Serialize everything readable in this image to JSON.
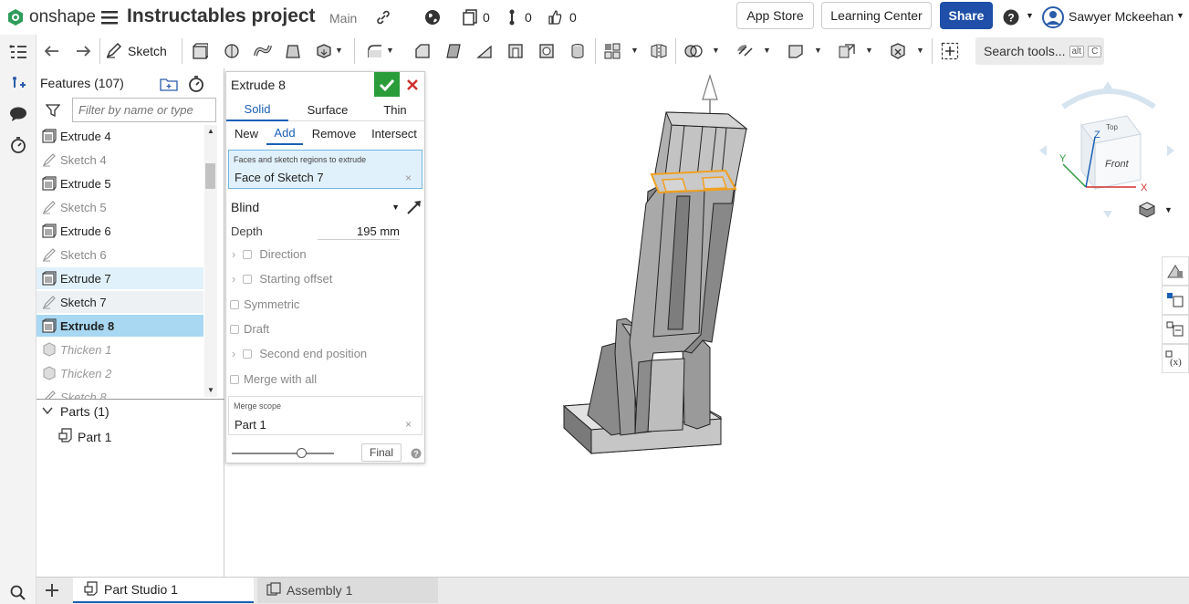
{
  "app": {
    "brand": "onshape",
    "doc_title": "Instructables project",
    "workspace": "Main"
  },
  "header": {
    "versions_count": "0",
    "branches_count": "0",
    "likes_count": "0",
    "app_store": "App Store",
    "learning_center": "Learning Center",
    "share": "Share",
    "user": "Sawyer Mckeehan"
  },
  "toolbar": {
    "sketch_label": "Sketch",
    "search_label": "Search tools...",
    "search_key1": "alt",
    "search_key2": "C"
  },
  "features": {
    "title": "Features (107)",
    "filter_placeholder": "Filter by name or type",
    "items": [
      {
        "label": "Extrude 4",
        "kind": "extrude",
        "state": "normal"
      },
      {
        "label": "Sketch 4",
        "kind": "sketch",
        "state": "dim"
      },
      {
        "label": "Extrude 5",
        "kind": "extrude",
        "state": "normal"
      },
      {
        "label": "Sketch 5",
        "kind": "sketch",
        "state": "dim"
      },
      {
        "label": "Extrude 6",
        "kind": "extrude",
        "state": "normal"
      },
      {
        "label": "Sketch 6",
        "kind": "sketch",
        "state": "dim"
      },
      {
        "label": "Extrude 7",
        "kind": "extrude",
        "state": "hover"
      },
      {
        "label": "Sketch 7",
        "kind": "sketch",
        "state": "hover2"
      },
      {
        "label": "Extrude 8",
        "kind": "extrude",
        "state": "selected"
      },
      {
        "label": "Thicken 1",
        "kind": "thicken",
        "state": "rolled"
      },
      {
        "label": "Thicken 2",
        "kind": "thicken",
        "state": "rolled"
      },
      {
        "label": "Sketch 8",
        "kind": "sketch",
        "state": "rolled"
      }
    ],
    "parts_label": "Parts (1)",
    "part_item": "Part 1"
  },
  "dialog": {
    "title": "Extrude 8",
    "type_tabs": [
      "Solid",
      "Surface",
      "Thin"
    ],
    "op_tabs": [
      "New",
      "Add",
      "Remove",
      "Intersect"
    ],
    "faces_caption": "Faces and sketch regions to extrude",
    "faces_value": "Face of Sketch 7",
    "end_type": "Blind",
    "depth_label": "Depth",
    "depth_value": "195 mm",
    "direction": "Direction",
    "starting_offset": "Starting offset",
    "symmetric": "Symmetric",
    "draft": "Draft",
    "second_end": "Second end position",
    "merge_all": "Merge with all",
    "merge_scope_caption": "Merge scope",
    "merge_scope_value": "Part 1",
    "final_label": "Final"
  },
  "viewcube": {
    "top": "Top",
    "front": "Front",
    "axis_x": "X",
    "axis_y": "Y",
    "axis_z": "Z"
  },
  "tabs": {
    "part_studio": "Part Studio 1",
    "assembly": "Assembly 1"
  },
  "colors": {
    "accent": "#1a5fb4",
    "share_bg": "#1f4fa8",
    "ok_green": "#2a9d3a",
    "close_red": "#d0312d",
    "selected_row": "#a8d8f2",
    "hover_row": "#e1f1fb",
    "edge_orange": "#f0a020"
  }
}
